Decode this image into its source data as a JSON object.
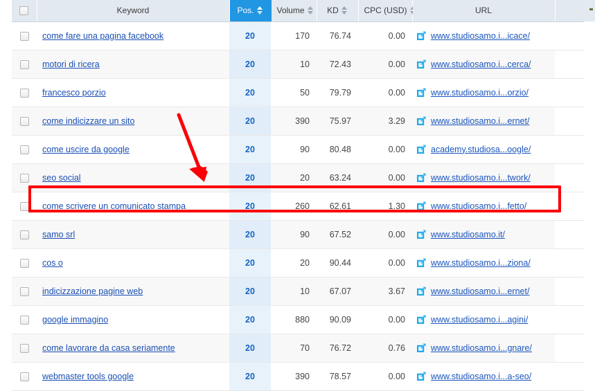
{
  "table": {
    "columns": [
      {
        "key": "check",
        "label": "",
        "sortable": false,
        "icon": "checkbox-icon"
      },
      {
        "key": "keyword",
        "label": "Keyword",
        "sortable": false
      },
      {
        "key": "pos",
        "label": "Pos.",
        "sortable": true,
        "active": true
      },
      {
        "key": "volume",
        "label": "Volume",
        "sortable": true
      },
      {
        "key": "kd",
        "label": "KD",
        "sortable": true
      },
      {
        "key": "cpc",
        "label": "CPC (USD)",
        "sortable": true
      },
      {
        "key": "url",
        "label": "URL",
        "sortable": false
      }
    ],
    "rows": [
      {
        "keyword": "come fare una pagina facebook",
        "pos": "20",
        "volume": "170",
        "kd": "76.74",
        "cpc": "0.00",
        "url": "www.studiosamo.i...icace/"
      },
      {
        "keyword": "motori di ricera",
        "pos": "20",
        "volume": "10",
        "kd": "72.43",
        "cpc": "0.00",
        "url": "www.studiosamo.i...cerca/"
      },
      {
        "keyword": "francesco porzio",
        "pos": "20",
        "volume": "50",
        "kd": "79.79",
        "cpc": "0.00",
        "url": "www.studiosamo.i...orzio/"
      },
      {
        "keyword": "come indicizzare un sito",
        "pos": "20",
        "volume": "390",
        "kd": "75.97",
        "cpc": "3.29",
        "url": "www.studiosamo.i...ernet/"
      },
      {
        "keyword": "come uscire da google",
        "pos": "20",
        "volume": "90",
        "kd": "80.48",
        "cpc": "0.00",
        "url": "academy.studiosa...oogle/"
      },
      {
        "keyword": "seo social",
        "pos": "20",
        "volume": "20",
        "kd": "63.24",
        "cpc": "0.00",
        "url": "www.studiosamo.i...twork/"
      },
      {
        "keyword": "come scrivere un comunicato stampa",
        "pos": "20",
        "volume": "260",
        "kd": "62.61",
        "cpc": "1.30",
        "url": "www.studiosamo.i...fetto/",
        "highlighted": true
      },
      {
        "keyword": "samo srl",
        "pos": "20",
        "volume": "90",
        "kd": "67.52",
        "cpc": "0.00",
        "url": "www.studiosamo.it/"
      },
      {
        "keyword": "cos o",
        "pos": "20",
        "volume": "20",
        "kd": "90.44",
        "cpc": "0.00",
        "url": "www.studiosamo.i...ziona/"
      },
      {
        "keyword": "indicizzazione pagine web",
        "pos": "20",
        "volume": "10",
        "kd": "67.07",
        "cpc": "3.67",
        "url": "www.studiosamo.i...ernet/"
      },
      {
        "keyword": "google immagino",
        "pos": "20",
        "volume": "880",
        "kd": "90.09",
        "cpc": "0.00",
        "url": "www.studiosamo.i...agini/"
      },
      {
        "keyword": "come lavorare da casa seriamente",
        "pos": "20",
        "volume": "70",
        "kd": "76.72",
        "cpc": "0.76",
        "url": "www.studiosamo.i...gnare/"
      },
      {
        "keyword": "webmaster tools google",
        "pos": "20",
        "volume": "390",
        "kd": "78.57",
        "cpc": "0.00",
        "url": "www.studiosamo.i...a-seo/"
      }
    ]
  },
  "annotations": {
    "highlight_color": "#fb0007",
    "arrow_color": "#fb0007",
    "highlighted_row_keyword": "come scrivere un comunicato stampa"
  },
  "colors": {
    "header_bg": "#e3e9f0",
    "active_column_bg": "#2196e3",
    "pos_cell_bg": "#e8f2fb",
    "link": "#1a4fb4",
    "pos_value": "#1565c0"
  }
}
